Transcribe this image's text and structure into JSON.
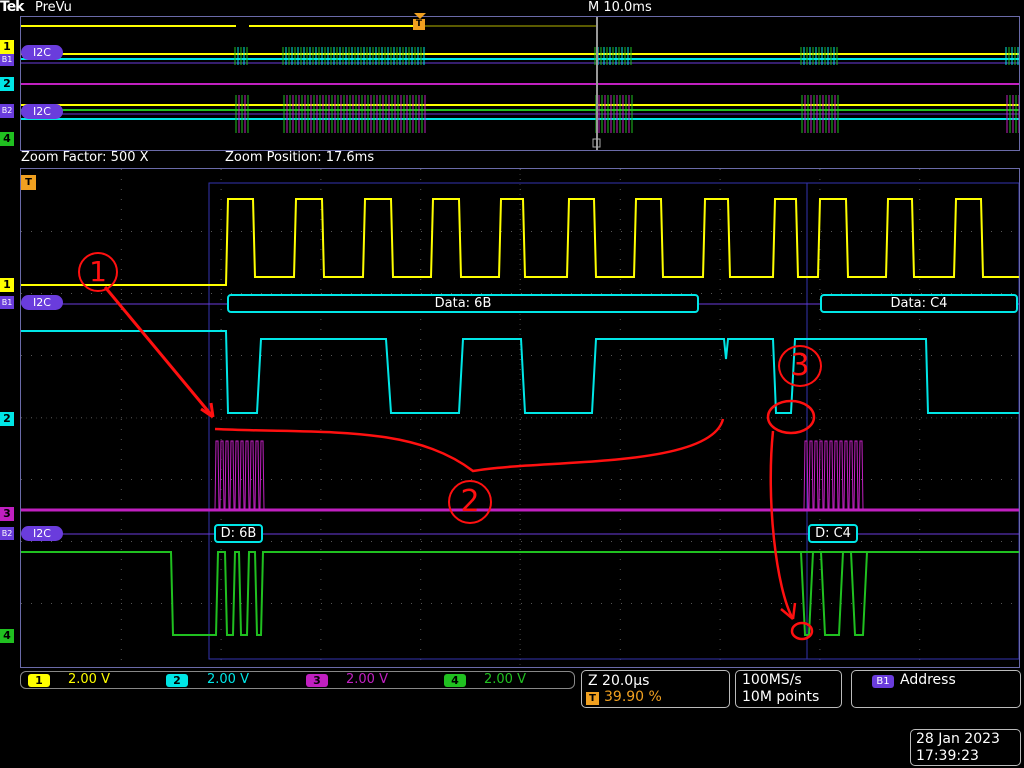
{
  "header": {
    "brand": "Tek",
    "mode": "PreVu",
    "timebase": "M 10.0ms"
  },
  "overview": {
    "trigger_marker": "T",
    "channel_labels": [
      "1",
      "B1",
      "2",
      "B2",
      "4"
    ],
    "bus_label": "I2C"
  },
  "zoom": {
    "factor_label": "Zoom Factor: 500 X",
    "position_label": "Zoom Position: 17.6ms"
  },
  "main": {
    "trigger_marker": "T",
    "markers": {
      "ch1": "1",
      "b1": "B1",
      "ch2": "2",
      "ch3": "3",
      "b2": "B2",
      "ch4": "4"
    },
    "bus_label": "I2C",
    "bus1_packets": [
      "Data: 6B",
      "Data: C4"
    ],
    "bus2_packets": [
      "D: 6B",
      "D: C4"
    ],
    "annotations": [
      "1",
      "2",
      "3"
    ]
  },
  "channels": [
    {
      "number": "1",
      "scale": "2.00 V",
      "color": "#ffff00"
    },
    {
      "number": "2",
      "scale": "2.00 V",
      "color": "#00e6e6"
    },
    {
      "number": "3",
      "scale": "2.00 V",
      "color": "#c020c0"
    },
    {
      "number": "4",
      "scale": "2.00 V",
      "color": "#20c020"
    }
  ],
  "horizontal": {
    "zoom_scale": "Z 20.0µs",
    "trigger_badge": "T",
    "trigger_position": "39.90 %",
    "sample_rate": "100MS/s",
    "record_length": "10M points"
  },
  "bus_trigger": {
    "badge": "B1",
    "label": "Address"
  },
  "datetime": {
    "date": "28 Jan  2023",
    "time": "17:39:23"
  },
  "colors": {
    "ch1": "#ffff00",
    "ch2": "#00e6e6",
    "ch3": "#c020c0",
    "ch4": "#20c020",
    "bus": "#6a3cdc",
    "annotation": "#ff1010",
    "trigger": "#f0a020"
  }
}
